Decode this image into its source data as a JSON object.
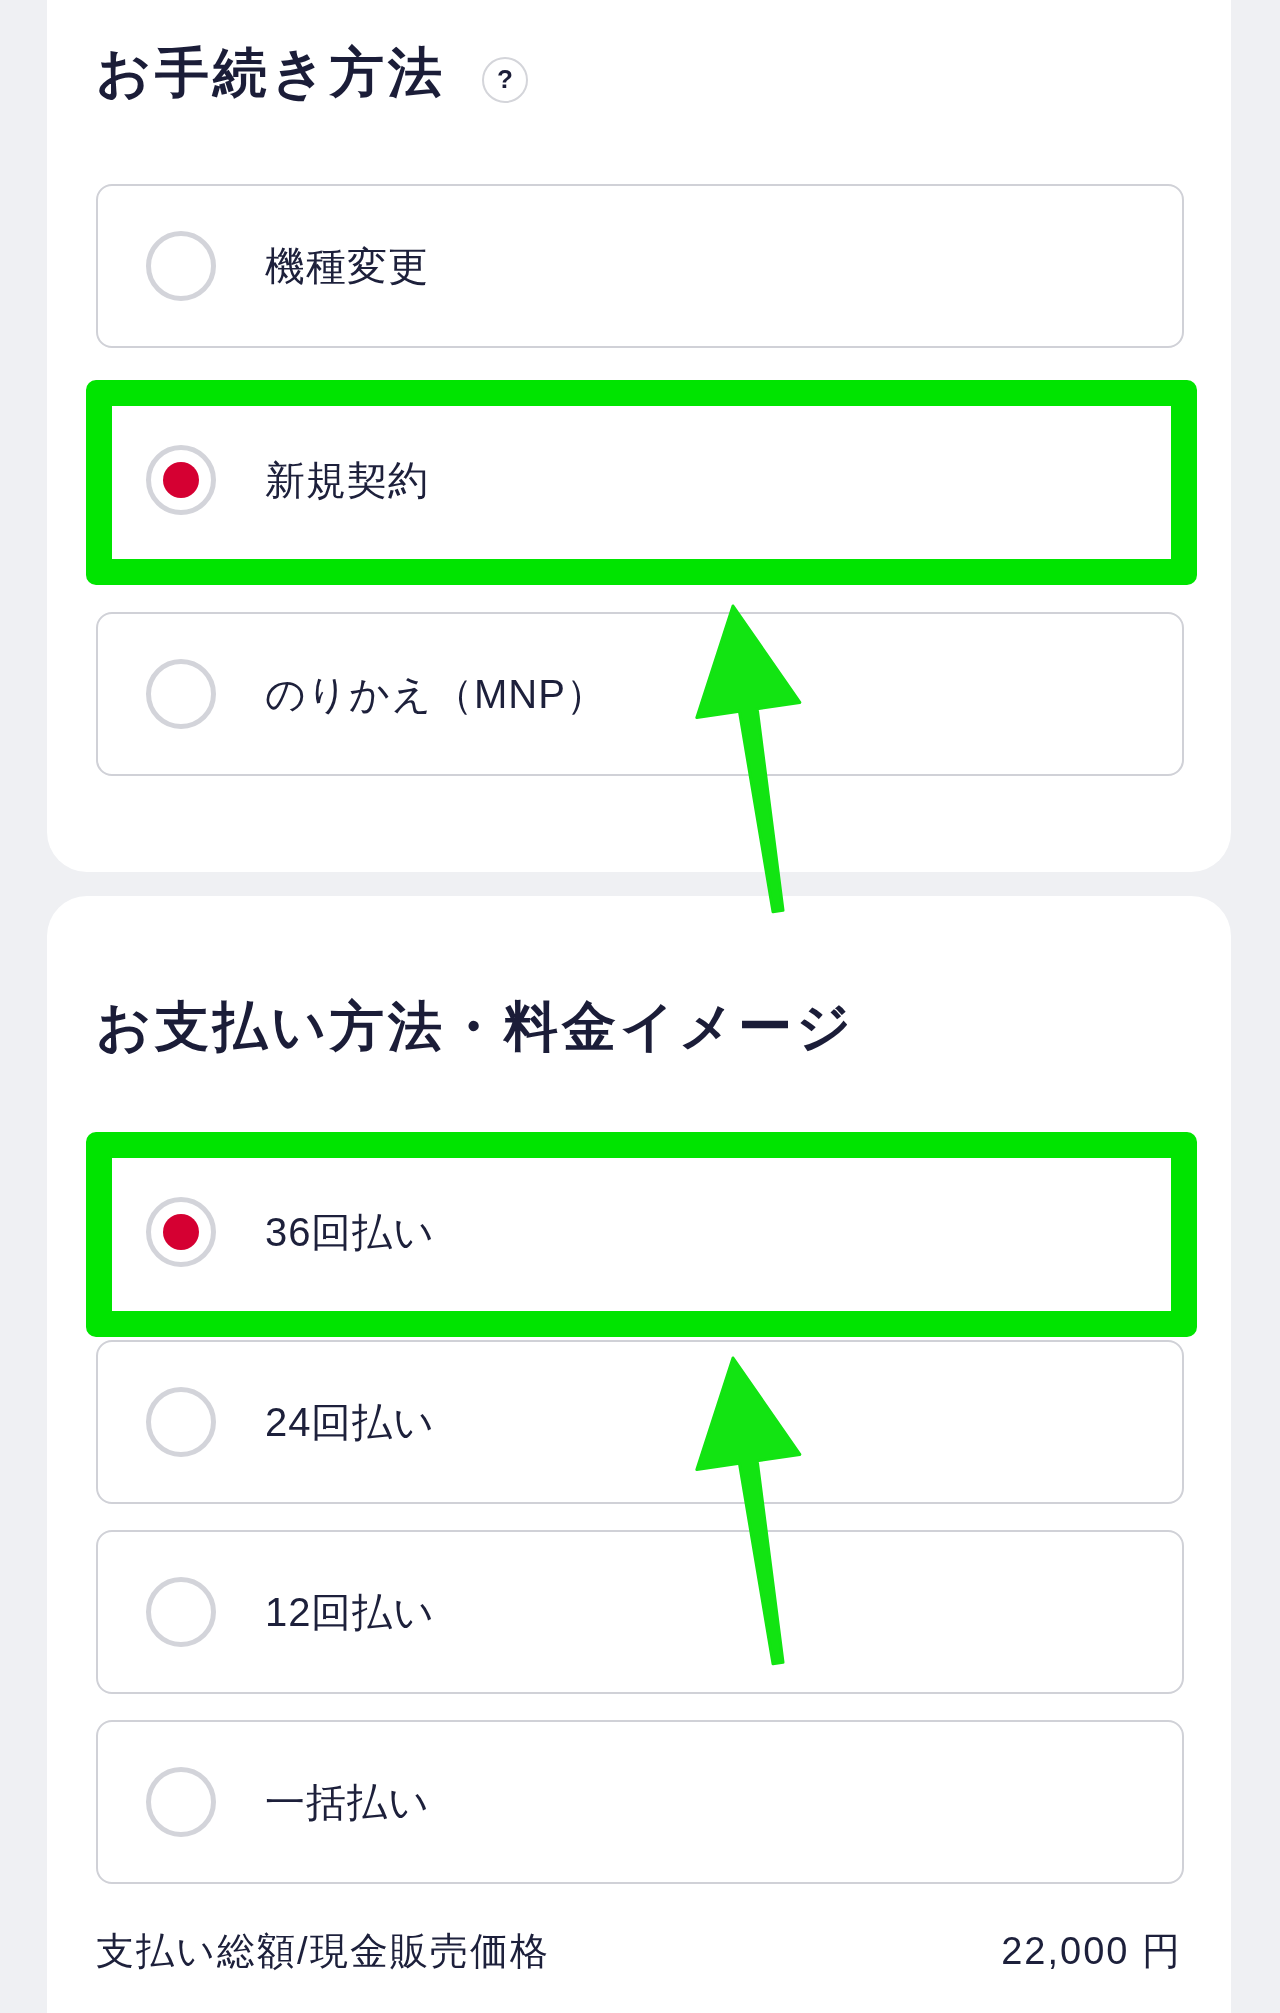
{
  "sections": [
    {
      "title": "お手続き方法",
      "help_button": "?",
      "options": [
        {
          "label": "機種変更",
          "selected": false,
          "highlighted": false
        },
        {
          "label": "新規契約",
          "selected": true,
          "highlighted": true
        },
        {
          "label": "のりかえ（MNP）",
          "selected": false,
          "highlighted": false
        }
      ]
    },
    {
      "title": "お支払い方法・料金イメージ",
      "options": [
        {
          "label": "36回払い",
          "selected": true,
          "highlighted": true
        },
        {
          "label": "24回払い",
          "selected": false,
          "highlighted": false
        },
        {
          "label": "12回払い",
          "selected": false,
          "highlighted": false
        },
        {
          "label": "一括払い",
          "selected": false,
          "highlighted": false
        }
      ],
      "summary": [
        {
          "label": "支払い総額/現金販売価格",
          "value": "22,000 円"
        }
      ]
    }
  ]
}
